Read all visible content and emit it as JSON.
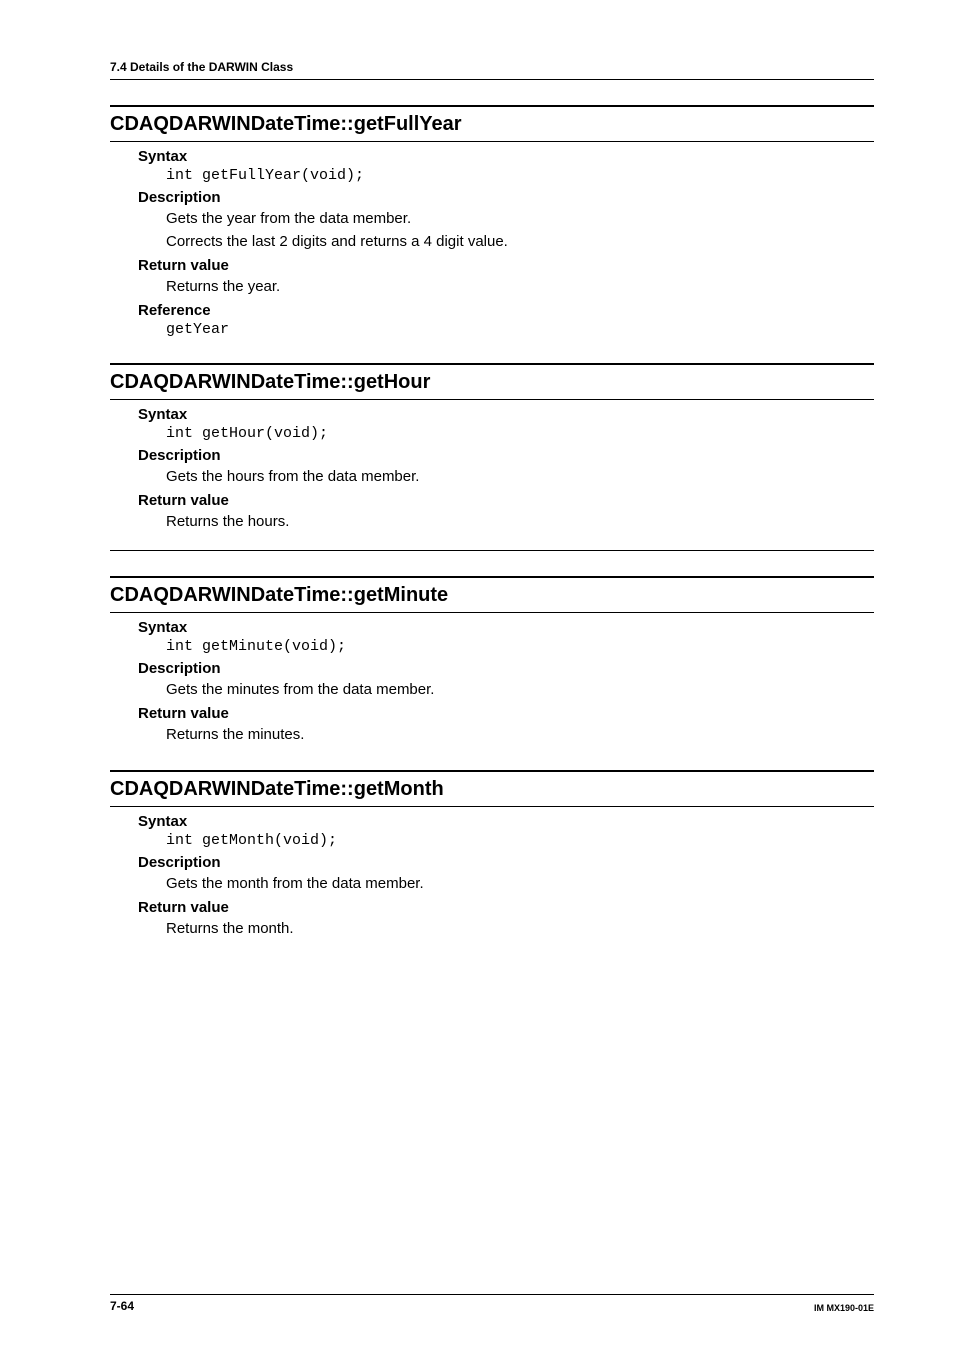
{
  "header": {
    "section_label": "7.4  Details of the DARWIN Class"
  },
  "entries": [
    {
      "title": "CDAQDARWINDateTime::getFullYear",
      "sections": [
        {
          "heading": "Syntax",
          "lines": [
            {
              "kind": "code",
              "text": "int getFullYear(void);"
            }
          ]
        },
        {
          "heading": "Description",
          "lines": [
            {
              "kind": "text",
              "text": "Gets the year from the data member."
            },
            {
              "kind": "text",
              "text": "Corrects the last 2 digits and returns a 4 digit value."
            }
          ]
        },
        {
          "heading": "Return value",
          "lines": [
            {
              "kind": "text",
              "text": "Returns the year."
            }
          ]
        },
        {
          "heading": "Reference",
          "lines": [
            {
              "kind": "code",
              "text": "getYear"
            }
          ]
        }
      ],
      "trailing_rule": false
    },
    {
      "title": "CDAQDARWINDateTime::getHour",
      "sections": [
        {
          "heading": "Syntax",
          "lines": [
            {
              "kind": "code",
              "text": "int getHour(void);"
            }
          ]
        },
        {
          "heading": "Description",
          "lines": [
            {
              "kind": "text",
              "text": "Gets the hours from the data member."
            }
          ]
        },
        {
          "heading": "Return value",
          "lines": [
            {
              "kind": "text",
              "text": "Returns the hours."
            }
          ]
        }
      ],
      "trailing_rule": true
    },
    {
      "title": "CDAQDARWINDateTime::getMinute",
      "sections": [
        {
          "heading": "Syntax",
          "lines": [
            {
              "kind": "code",
              "text": "int getMinute(void);"
            }
          ]
        },
        {
          "heading": "Description",
          "lines": [
            {
              "kind": "text",
              "text": "Gets the minutes from the data member."
            }
          ]
        },
        {
          "heading": "Return value",
          "lines": [
            {
              "kind": "text",
              "text": "Returns the minutes."
            }
          ]
        }
      ],
      "trailing_rule": false
    },
    {
      "title": "CDAQDARWINDateTime::getMonth",
      "sections": [
        {
          "heading": "Syntax",
          "lines": [
            {
              "kind": "code",
              "text": "int getMonth(void);"
            }
          ]
        },
        {
          "heading": "Description",
          "lines": [
            {
              "kind": "text",
              "text": "Gets the month from the data member."
            }
          ]
        },
        {
          "heading": "Return value",
          "lines": [
            {
              "kind": "text",
              "text": "Returns the month."
            }
          ]
        }
      ],
      "trailing_rule": false
    }
  ],
  "footer": {
    "page_number": "7-64",
    "doc_code": "IM MX190-01E"
  }
}
